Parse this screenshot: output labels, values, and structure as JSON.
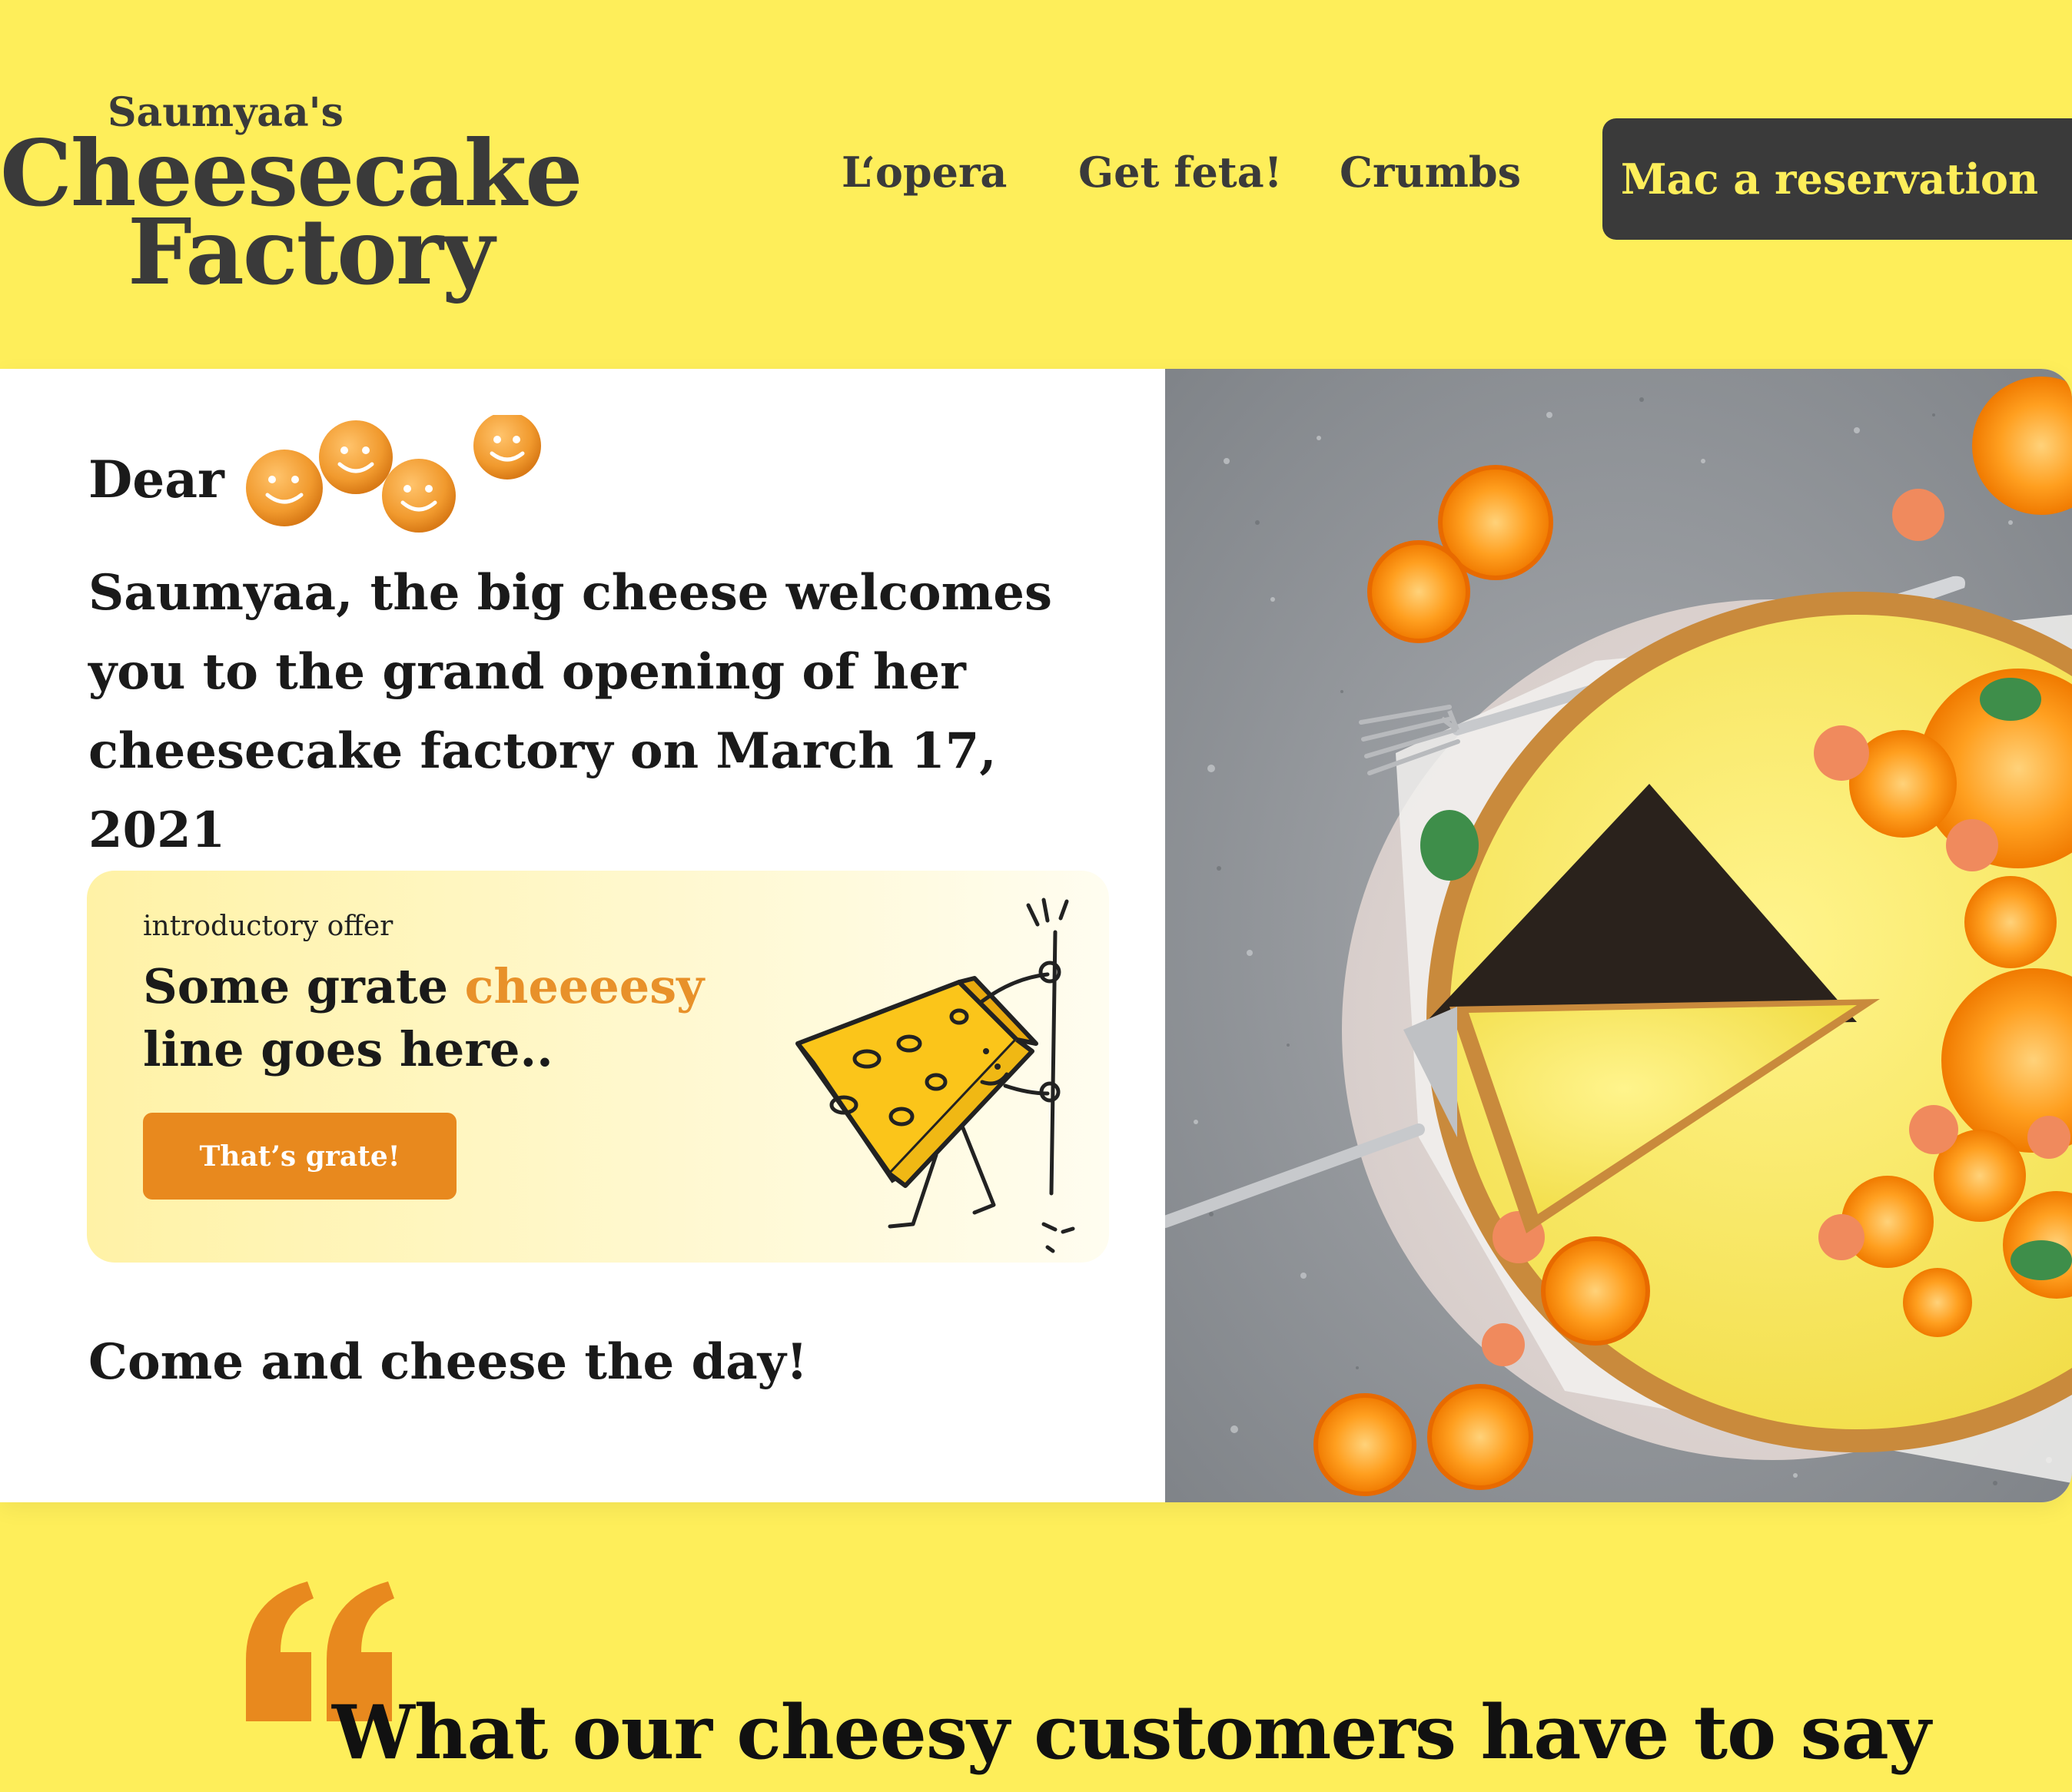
{
  "brand": {
    "line1": "Saumyaa's",
    "line2": "Cheesecake",
    "line3": "Factory"
  },
  "nav": {
    "items": [
      "L‘opera",
      "Get feta!",
      "Crumbs"
    ],
    "cta_label": "Mac a reservation"
  },
  "invite": {
    "greeting": "Dear",
    "message": "Saumyaa, the big cheese welcomes you to the grand opening of her cheesecake factory on March 17, 2021",
    "closing": "Come and cheese the day!"
  },
  "offer": {
    "tag": "introductory offer",
    "line_start": "Some grate ",
    "line_highlight": "cheeeesy",
    "line_end": "line goes here..",
    "button_label": "That’s grate!"
  },
  "testimonials": {
    "title": "What our cheesy customers have to say"
  },
  "colors": {
    "background": "#FEEE5A",
    "dark": "#3a3a3a",
    "accent": "#E8891E",
    "highlight": "#E8912A",
    "card": "#ffffff"
  },
  "icons": {
    "puffs": "smiley-cheese-puff-icons",
    "cheese": "cheese-character-drawing",
    "quote": "quote-mark-icon"
  }
}
